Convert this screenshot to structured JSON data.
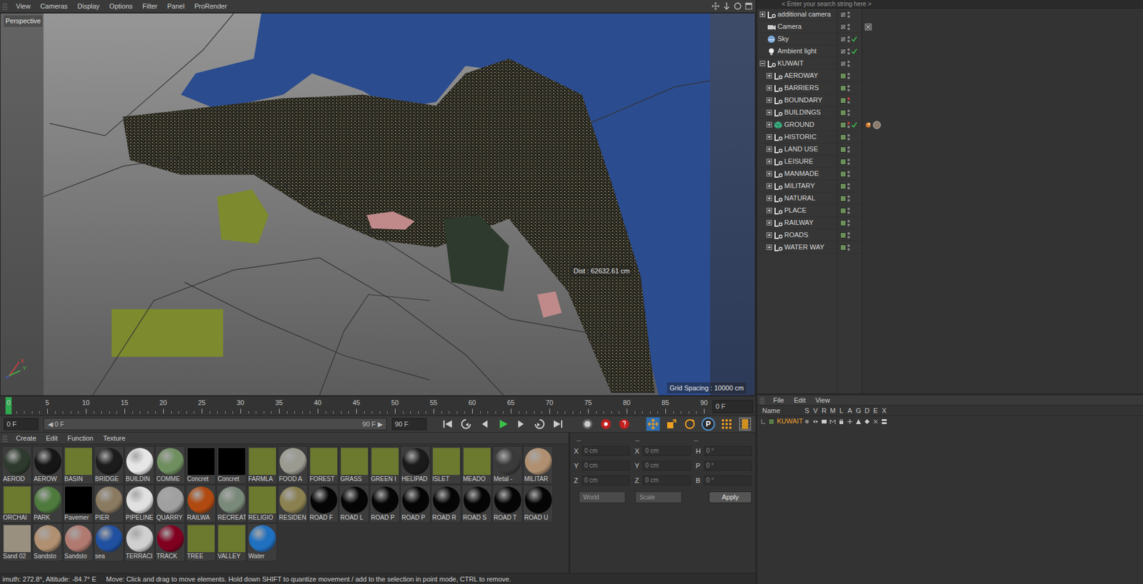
{
  "viewport": {
    "menu": [
      "View",
      "Cameras",
      "Display",
      "Options",
      "Filter",
      "Panel",
      "ProRender"
    ],
    "label": "Perspective",
    "dist": "Dist : 62632.61 cm",
    "grid_spacing": "Grid Spacing : 10000 cm",
    "axes": [
      "X",
      "Y"
    ]
  },
  "timeline": {
    "ticks": [
      "0",
      "5",
      "10",
      "15",
      "20",
      "25",
      "30",
      "35",
      "40",
      "45",
      "50",
      "55",
      "60",
      "65",
      "70",
      "75",
      "80",
      "85",
      "90"
    ],
    "playhead_level": 0,
    "frame_field": "0 F"
  },
  "transport": {
    "start": "0 F",
    "slider_start": "◀ 0 F",
    "slider_end": "90 F ▶",
    "end": "90 F",
    "p_label": "P"
  },
  "materials": {
    "menu": [
      "Create",
      "Edit",
      "Function",
      "Texture"
    ],
    "items": [
      {
        "label": "AEROD",
        "color": "#2d3a2d",
        "kind": "sphere"
      },
      {
        "label": "AEROW",
        "color": "#161616",
        "kind": "sphere"
      },
      {
        "label": "BASIN",
        "color": "#6b7a2e",
        "kind": "flat"
      },
      {
        "label": "BRIDGE",
        "color": "#1c1c1c",
        "kind": "sphere"
      },
      {
        "label": "BUILDIN",
        "color": "#e6e6e6",
        "kind": "sphere"
      },
      {
        "label": "COMME",
        "color": "#6f8f5f",
        "kind": "sphere"
      },
      {
        "label": "Concret",
        "color": "#000000",
        "kind": "flat"
      },
      {
        "label": "Concret",
        "color": "#000000",
        "kind": "flat"
      },
      {
        "label": "FARMLA",
        "color": "#6b7a2e",
        "kind": "flat"
      },
      {
        "label": "FOOD A",
        "color": "#9a9a90",
        "kind": "sphere"
      },
      {
        "label": "FOREST",
        "color": "#6b7a2e",
        "kind": "flat"
      },
      {
        "label": "GRASS",
        "color": "#6b7a2e",
        "kind": "flat"
      },
      {
        "label": "GREEN I",
        "color": "#6b7a2e",
        "kind": "flat"
      },
      {
        "label": "HELIPAD",
        "color": "#1a1a1a",
        "kind": "sphere"
      },
      {
        "label": "ISLET",
        "color": "#6b7a2e",
        "kind": "flat"
      },
      {
        "label": "MEADO",
        "color": "#6b7a2e",
        "kind": "flat"
      },
      {
        "label": "Metal -",
        "color": "#3a3a3a",
        "kind": "sphere"
      },
      {
        "label": "MILITAR",
        "color": "#b09070",
        "kind": "sphere"
      },
      {
        "label": "ORCHAI",
        "color": "#6b7a2e",
        "kind": "flat"
      },
      {
        "label": "PARK",
        "color": "#4e7a3e",
        "kind": "sphere"
      },
      {
        "label": "Pavemer",
        "color": "#000000",
        "kind": "flat"
      },
      {
        "label": "PIER",
        "color": "#8a7a60",
        "kind": "sphere"
      },
      {
        "label": "PIPELINE",
        "color": "#e0e0e0",
        "kind": "sphere"
      },
      {
        "label": "QUARRY",
        "color": "#a0a0a0",
        "kind": "sphere"
      },
      {
        "label": "RAILWA",
        "color": "#b04a10",
        "kind": "sphere"
      },
      {
        "label": "RECREAT",
        "color": "#7a8a7a",
        "kind": "sphere"
      },
      {
        "label": "RELIGIO",
        "color": "#6b7a2e",
        "kind": "flat"
      },
      {
        "label": "RESIDEN",
        "color": "#8a8050",
        "kind": "sphere"
      },
      {
        "label": "ROAD F",
        "color": "#050505",
        "kind": "sphere"
      },
      {
        "label": "ROAD L",
        "color": "#050505",
        "kind": "sphere"
      },
      {
        "label": "ROAD P",
        "color": "#050505",
        "kind": "sphere"
      },
      {
        "label": "ROAD P",
        "color": "#050505",
        "kind": "sphere"
      },
      {
        "label": "ROAD R",
        "color": "#050505",
        "kind": "sphere"
      },
      {
        "label": "ROAD S",
        "color": "#050505",
        "kind": "sphere"
      },
      {
        "label": "ROAD T",
        "color": "#050505",
        "kind": "sphere"
      },
      {
        "label": "ROAD U",
        "color": "#050505",
        "kind": "sphere"
      },
      {
        "label": "Sand 02",
        "color": "#9a9080",
        "kind": "flat"
      },
      {
        "label": "Sandsto",
        "color": "#b09070",
        "kind": "sphere"
      },
      {
        "label": "Sandsto",
        "color": "#b07a70",
        "kind": "sphere"
      },
      {
        "label": "sea",
        "color": "#2050a0",
        "kind": "sphere"
      },
      {
        "label": "TERRACI",
        "color": "#d0d0d0",
        "kind": "sphere"
      },
      {
        "label": "TRACK",
        "color": "#800020",
        "kind": "sphere"
      },
      {
        "label": "TREE",
        "color": "#6b7a2e",
        "kind": "flat"
      },
      {
        "label": "VALLEY",
        "color": "#6b7a2e",
        "kind": "flat"
      },
      {
        "label": "Water",
        "color": "#2070c0",
        "kind": "sphere"
      }
    ]
  },
  "coordinates": {
    "headers": [
      "--",
      "--",
      "--"
    ],
    "rows": [
      {
        "axis": "X",
        "pos": "0 cm",
        "size_axis": "X",
        "size": "0 cm",
        "rot_axis": "H",
        "rot": "0 °"
      },
      {
        "axis": "Y",
        "pos": "0 cm",
        "size_axis": "Y",
        "size": "0 cm",
        "rot_axis": "P",
        "rot": "0 °"
      },
      {
        "axis": "Z",
        "pos": "0 cm",
        "size_axis": "Z",
        "size": "0 cm",
        "rot_axis": "B",
        "rot": "0 °"
      }
    ],
    "mode": "World",
    "size_mode": "Scale",
    "apply": "Apply"
  },
  "status_bar": {
    "text": "imuth: 272.8°, Altitude: -84.7°  E",
    "hint": "Move: Click and drag to move elements. Hold down SHIFT to quantize movement / add to the selection in point mode, CTRL to remove."
  },
  "objects": {
    "search": {
      "placeholder": "< Enter your search string here >"
    },
    "items": [
      {
        "name": "additional camera",
        "kind": "null",
        "expandable": true,
        "expanded": false,
        "checked": false,
        "has_tags": false,
        "dot_color": "#8a8a8a"
      },
      {
        "name": "Camera",
        "kind": "camera",
        "expandable": false,
        "expanded": false,
        "checked": false,
        "has_tags": true,
        "dot_color": "#8a8a8a"
      },
      {
        "name": "Sky",
        "kind": "sky",
        "expandable": false,
        "expanded": false,
        "checked": true,
        "has_tags": false,
        "dot_color": "#8a8a8a"
      },
      {
        "name": "Ambient light",
        "kind": "light",
        "expandable": false,
        "expanded": false,
        "checked": true,
        "has_tags": false,
        "dot_color": "#8a8a8a"
      },
      {
        "name": "KUWAIT",
        "kind": "null",
        "expandable": true,
        "expanded": true,
        "checked": false,
        "has_tags": false,
        "dot_color": "#8a8a8a",
        "children": [
          {
            "name": "AEROWAY",
            "kind": "null",
            "expandable": true,
            "expanded": false,
            "checked": false,
            "has_tags": false,
            "dot_color": "#8a8a8a",
            "layer_color": "#6a8f5a"
          },
          {
            "name": "BARRIERS",
            "kind": "null",
            "expandable": true,
            "expanded": false,
            "checked": false,
            "has_tags": false,
            "dot_color": "#8a8a8a",
            "layer_color": "#6a8f5a"
          },
          {
            "name": "BOUNDARY",
            "kind": "null",
            "expandable": true,
            "expanded": false,
            "checked": false,
            "has_tags": false,
            "dot_color": "#d04040",
            "layer_color": "#6a8f5a"
          },
          {
            "name": "BUILDINGS",
            "kind": "null",
            "expandable": true,
            "expanded": false,
            "checked": false,
            "has_tags": false,
            "dot_color": "#8a8a8a",
            "layer_color": "#6a8f5a"
          },
          {
            "name": "GROUND",
            "kind": "polygon",
            "expandable": true,
            "expanded": false,
            "checked": true,
            "has_tags": true,
            "dot_color": "#d04040",
            "layer_color": "#6a8f5a"
          },
          {
            "name": "HISTORIC",
            "kind": "null",
            "expandable": true,
            "expanded": false,
            "checked": false,
            "has_tags": false,
            "dot_color": "#8a8a8a",
            "layer_color": "#6a8f5a"
          },
          {
            "name": "LAND USE",
            "kind": "null",
            "expandable": true,
            "expanded": false,
            "checked": false,
            "has_tags": false,
            "dot_color": "#8a8a8a",
            "layer_color": "#6a8f5a"
          },
          {
            "name": "LEISURE",
            "kind": "null",
            "expandable": true,
            "expanded": false,
            "checked": false,
            "has_tags": false,
            "dot_color": "#8a8a8a",
            "layer_color": "#6a8f5a"
          },
          {
            "name": "MANMADE",
            "kind": "null",
            "expandable": true,
            "expanded": false,
            "checked": false,
            "has_tags": false,
            "dot_color": "#8a8a8a",
            "layer_color": "#6a8f5a"
          },
          {
            "name": "MILITARY",
            "kind": "null",
            "expandable": true,
            "expanded": false,
            "checked": false,
            "has_tags": false,
            "dot_color": "#8a8a8a",
            "layer_color": "#6a8f5a"
          },
          {
            "name": "NATURAL",
            "kind": "null",
            "expandable": true,
            "expanded": false,
            "checked": false,
            "has_tags": false,
            "dot_color": "#8a8a8a",
            "layer_color": "#6a8f5a"
          },
          {
            "name": "PLACE",
            "kind": "null",
            "expandable": true,
            "expanded": false,
            "checked": false,
            "has_tags": false,
            "dot_color": "#8a8a8a",
            "layer_color": "#6a8f5a"
          },
          {
            "name": "RAILWAY",
            "kind": "null",
            "expandable": true,
            "expanded": false,
            "checked": false,
            "has_tags": false,
            "dot_color": "#8a8a8a",
            "layer_color": "#6a8f5a"
          },
          {
            "name": "ROADS",
            "kind": "null",
            "expandable": true,
            "expanded": false,
            "checked": false,
            "has_tags": false,
            "dot_color": "#8a8a8a",
            "layer_color": "#6a8f5a"
          },
          {
            "name": "WATER WAY",
            "kind": "null",
            "expandable": true,
            "expanded": false,
            "checked": false,
            "has_tags": false,
            "dot_color": "#8a8a8a",
            "layer_color": "#6a8f5a"
          }
        ]
      }
    ]
  },
  "layers": {
    "menu": [
      "File",
      "Edit",
      "View"
    ],
    "columns": [
      "Name",
      "S",
      "V",
      "R",
      "M",
      "L",
      "A",
      "G",
      "D",
      "E",
      "X"
    ],
    "rows": [
      {
        "name": "KUWAIT",
        "selected": true,
        "color": "#5a7a4a"
      }
    ]
  }
}
